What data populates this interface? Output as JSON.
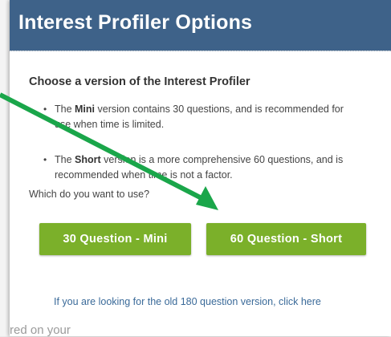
{
  "dialog": {
    "title": "Interest Profiler Options",
    "heading": "Choose a version of the Interest Profiler",
    "bullets": [
      {
        "pre": "The ",
        "bold": "Mini",
        "post": " version contains 30 questions, and is recommended for",
        "line2": "use when time is limited."
      },
      {
        "pre": "The ",
        "bold": "Short",
        "post": " version is a more comprehensive 60 questions, and is",
        "line2": "recommended when time is not a factor."
      }
    ],
    "question": "Which do you want to use?",
    "buttons": {
      "mini": "30 Question - Mini",
      "short": "60 Question - Short"
    },
    "old_version_link": "If you are looking for the old 180 question version, click here"
  },
  "backdrop": {
    "partial_text": "red on your"
  },
  "annotation": {
    "arrow_color": "#1aa64a"
  },
  "colors": {
    "header": "#3e6289",
    "button": "#7bb02a",
    "link": "#3a6a99"
  }
}
